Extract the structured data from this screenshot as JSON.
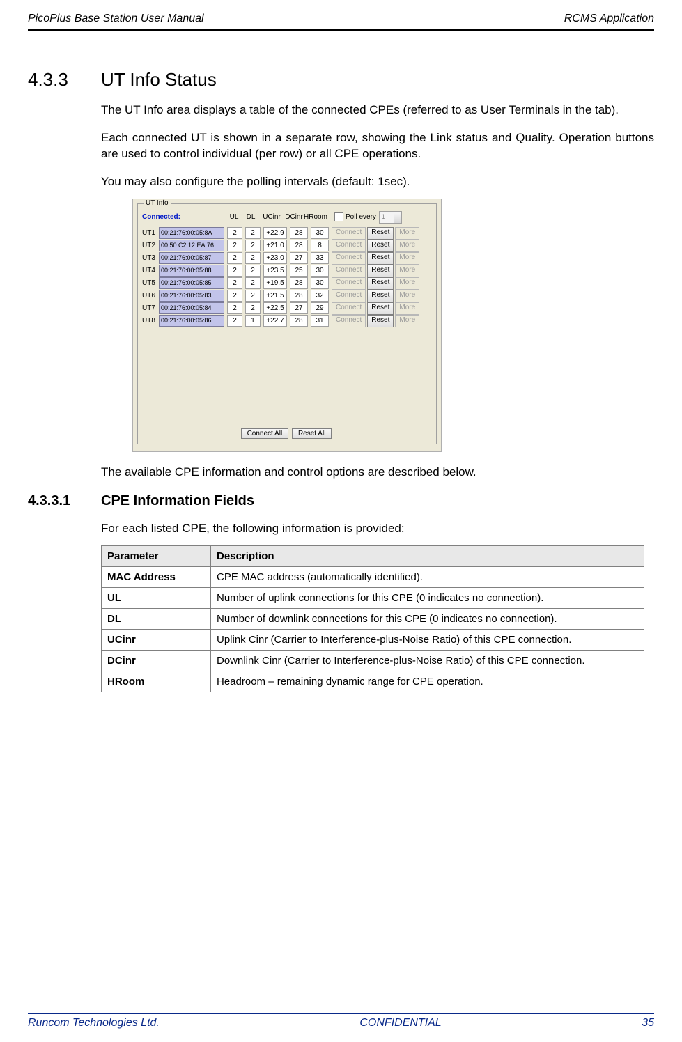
{
  "header": {
    "left": "PicoPlus Base Station User Manual",
    "right": "RCMS Application"
  },
  "section": {
    "number": "4.3.3",
    "title": "UT Info Status"
  },
  "paragraphs": {
    "p1": "The UT Info area displays a table of the connected CPEs (referred to as User Terminals in the tab).",
    "p2": "Each connected UT is shown in a separate row, showing the Link status and Quality. Operation buttons are used to control individual (per row) or all CPE operations.",
    "p3": "You may also configure the polling intervals (default: 1sec).",
    "p4": "The available CPE information and control options are described below."
  },
  "figure": {
    "group_label": "UT Info",
    "connected_label": "Connected:",
    "col_heads": {
      "ul": "UL",
      "dl": "DL",
      "ucinr": "UCinr",
      "dcinr": "DCinr",
      "hroom": "HRoom"
    },
    "poll_label": "Poll every",
    "spinner_value": "1",
    "row_buttons": {
      "connect": "Connect",
      "reset": "Reset",
      "more": "More"
    },
    "rows": [
      {
        "id": "UT1",
        "mac": "00:21:76:00:05:8A",
        "ul": "2",
        "dl": "2",
        "uc": "+22.9",
        "dc": "28",
        "hr": "30"
      },
      {
        "id": "UT2",
        "mac": "00:50:C2:12:EA:76",
        "ul": "2",
        "dl": "2",
        "uc": "+21.0",
        "dc": "28",
        "hr": "8"
      },
      {
        "id": "UT3",
        "mac": "00:21:76:00:05:87",
        "ul": "2",
        "dl": "2",
        "uc": "+23.0",
        "dc": "27",
        "hr": "33"
      },
      {
        "id": "UT4",
        "mac": "00:21:76:00:05:88",
        "ul": "2",
        "dl": "2",
        "uc": "+23.5",
        "dc": "25",
        "hr": "30"
      },
      {
        "id": "UT5",
        "mac": "00:21:76:00:05:85",
        "ul": "2",
        "dl": "2",
        "uc": "+19.5",
        "dc": "28",
        "hr": "30"
      },
      {
        "id": "UT6",
        "mac": "00:21:76:00:05:83",
        "ul": "2",
        "dl": "2",
        "uc": "+21.5",
        "dc": "28",
        "hr": "32"
      },
      {
        "id": "UT7",
        "mac": "00:21:76:00:05:84",
        "ul": "2",
        "dl": "2",
        "uc": "+22.5",
        "dc": "27",
        "hr": "29"
      },
      {
        "id": "UT8",
        "mac": "00:21:76:00:05:86",
        "ul": "2",
        "dl": "1",
        "uc": "+22.7",
        "dc": "28",
        "hr": "31"
      }
    ],
    "bottom": {
      "connect_all": "Connect All",
      "reset_all": "Reset All"
    }
  },
  "subsection": {
    "number": "4.3.3.1",
    "title": "CPE Information Fields"
  },
  "sub_intro": "For each listed CPE, the following information is provided:",
  "param_table": {
    "head_param": "Parameter",
    "head_desc": "Description",
    "rows": [
      {
        "param": " MAC Address",
        "desc": " CPE MAC address (automatically identified)."
      },
      {
        "param": " UL",
        "desc": "Number of uplink connections for this CPE (0 indicates no connection)."
      },
      {
        "param": " DL",
        "desc": "Number of downlink connections for this CPE (0 indicates no connection)."
      },
      {
        "param": "UCinr",
        "desc": "Uplink Cinr (Carrier to Interference-plus-Noise Ratio) of this CPE connection."
      },
      {
        "param": "DCinr",
        "desc": "Downlink Cinr (Carrier to Interference-plus-Noise Ratio) of this CPE connection."
      },
      {
        "param": "HRoom",
        "desc": "Headroom – remaining dynamic range for CPE operation."
      }
    ]
  },
  "footer": {
    "left": "Runcom Technologies Ltd.",
    "center": "CONFIDENTIAL",
    "right": "35"
  }
}
